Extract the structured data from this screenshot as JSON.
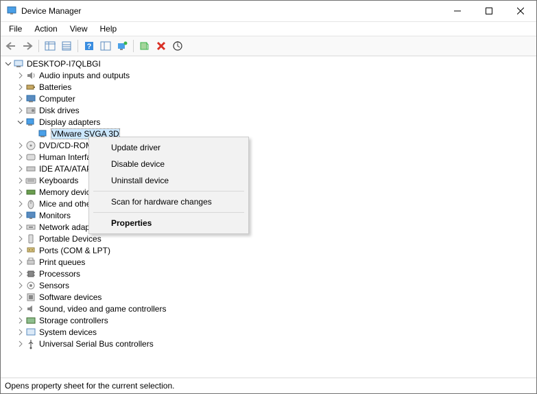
{
  "window": {
    "title": "Device Manager"
  },
  "menu": {
    "file": "File",
    "action": "Action",
    "view": "View",
    "help": "Help"
  },
  "tree": {
    "root": "DESKTOP-I7QLBGI",
    "audio": "Audio inputs and outputs",
    "batteries": "Batteries",
    "computer": "Computer",
    "disk": "Disk drives",
    "display": "Display adapters",
    "display_child": "VMware SVGA 3D",
    "dvd": "DVD/CD-ROM drives",
    "hid": "Human Interface Devices",
    "ide": "IDE ATA/ATAPI controllers",
    "keyboards": "Keyboards",
    "memory": "Memory devices",
    "mice": "Mice and other pointing devices",
    "monitors": "Monitors",
    "network": "Network adapters",
    "portable": "Portable Devices",
    "ports": "Ports (COM & LPT)",
    "printq": "Print queues",
    "processors": "Processors",
    "sensors": "Sensors",
    "software": "Software devices",
    "sound": "Sound, video and game controllers",
    "storage": "Storage controllers",
    "system": "System devices",
    "usb": "Universal Serial Bus controllers"
  },
  "context_menu": {
    "update": "Update driver",
    "disable": "Disable device",
    "uninstall": "Uninstall device",
    "scan": "Scan for hardware changes",
    "properties": "Properties"
  },
  "statusbar": {
    "text": "Opens property sheet for the current selection."
  }
}
